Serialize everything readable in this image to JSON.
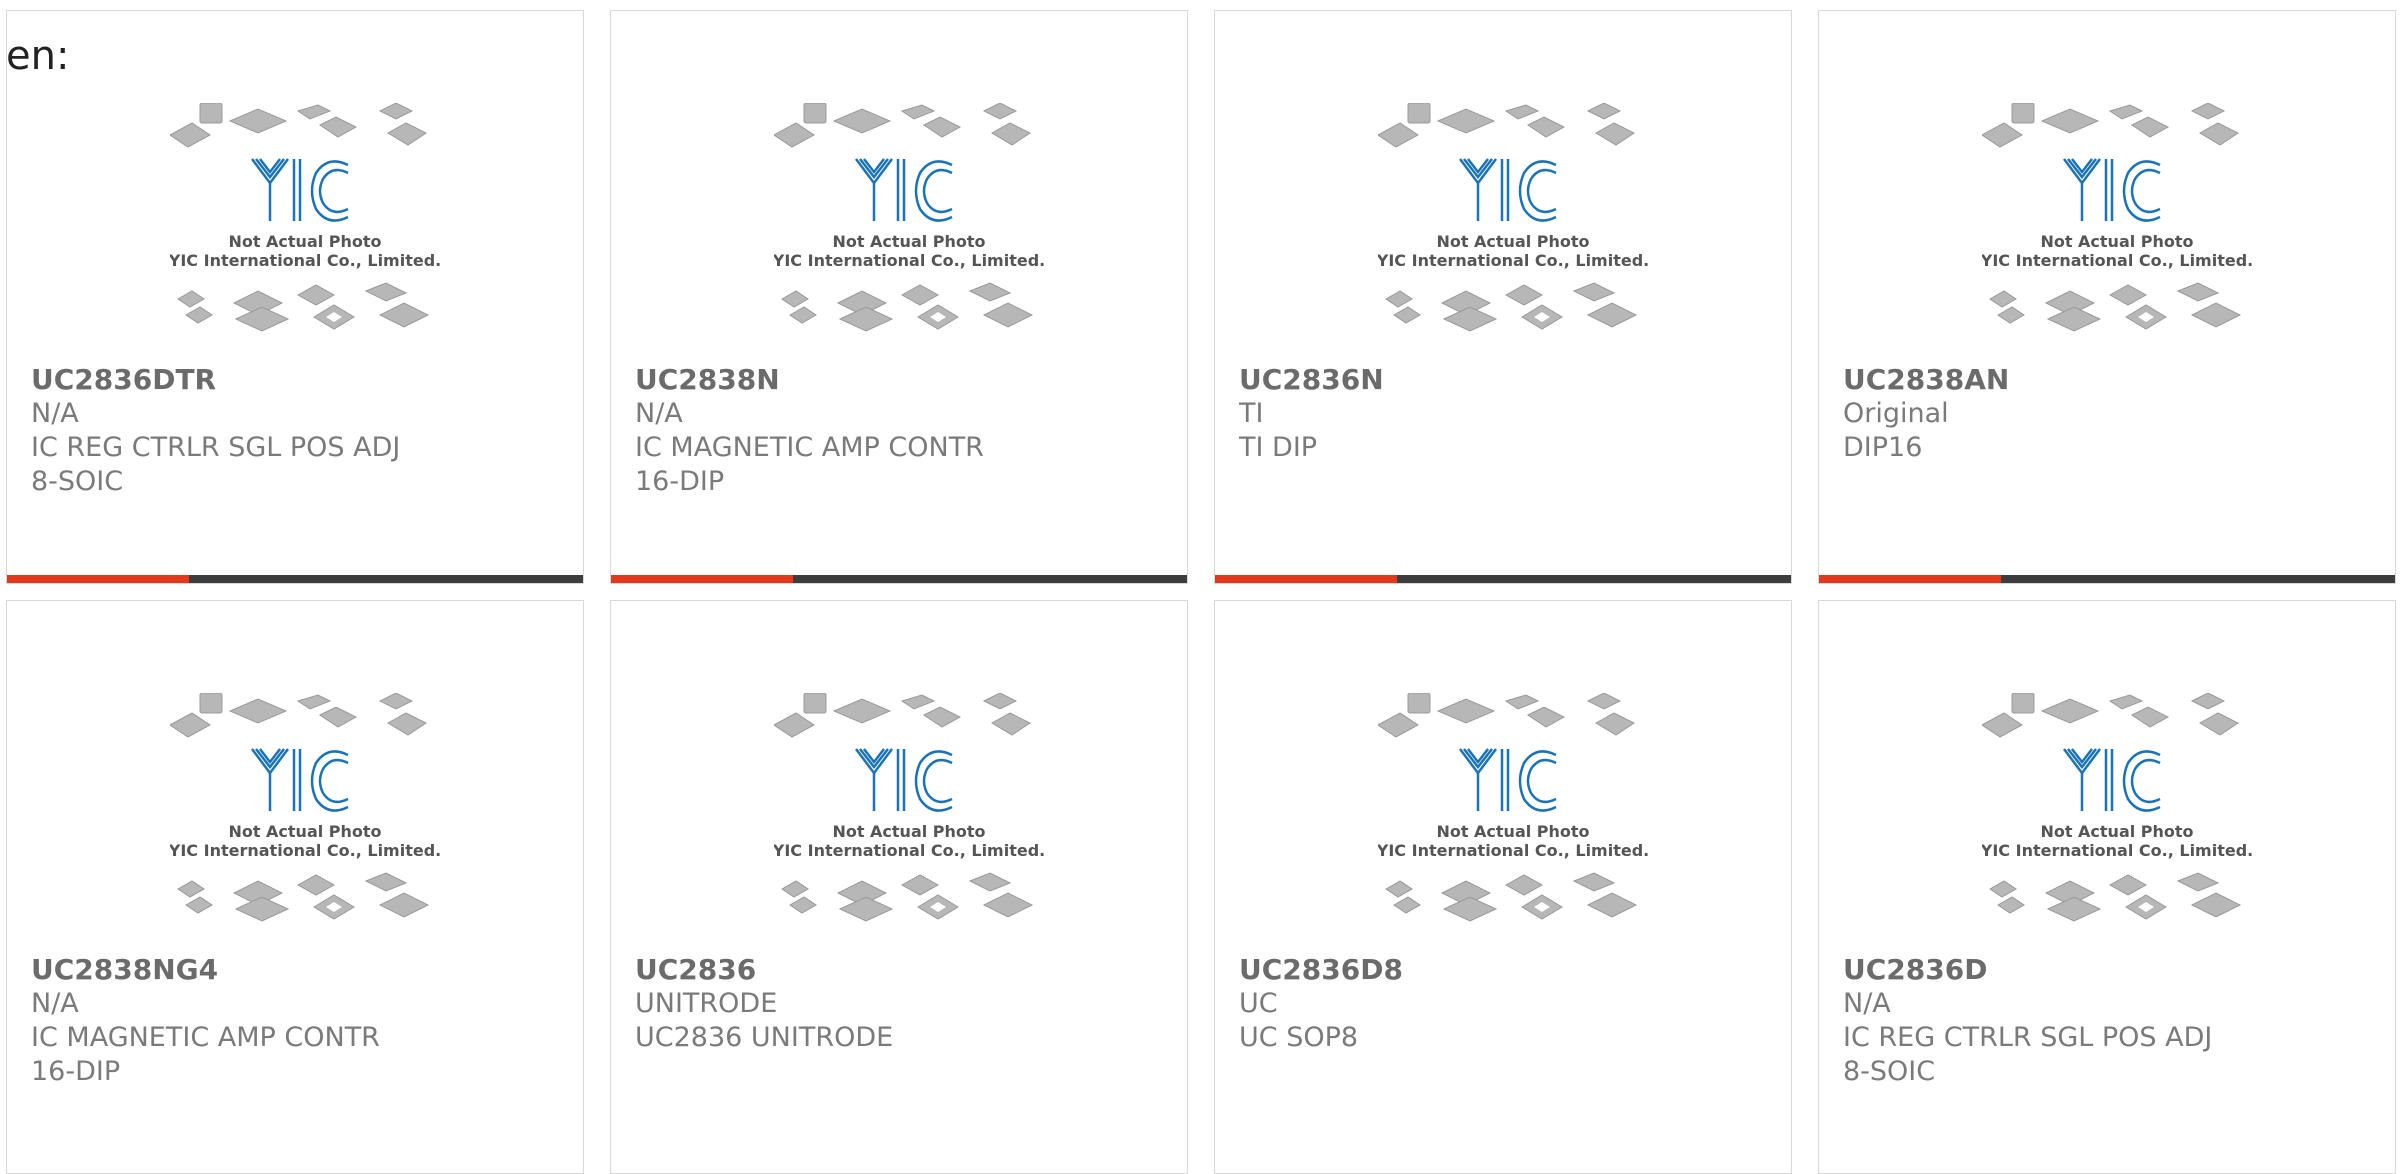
{
  "page": {
    "language_label": "en:"
  },
  "image_caption": {
    "line1": "Not Actual Photo",
    "line2": "YIC International Co., Limited."
  },
  "colors": {
    "accent_bar": "#e2381d",
    "dark_bar": "#3d3d3d",
    "logo_blue": "#1a73b9",
    "text_gray": "#7a7a7a"
  },
  "products": [
    {
      "part_number": "UC2836DTR",
      "manufacturer": "N/A",
      "description": "IC REG CTRLR SGL POS ADJ 8-SOIC"
    },
    {
      "part_number": "UC2838N",
      "manufacturer": "N/A",
      "description": "IC MAGNETIC AMP CONTR 16-DIP"
    },
    {
      "part_number": "UC2836N",
      "manufacturer": "TI",
      "description": "TI DIP"
    },
    {
      "part_number": "UC2838AN",
      "manufacturer": "Original",
      "description": "DIP16"
    },
    {
      "part_number": "UC2838NG4",
      "manufacturer": "N/A",
      "description": "IC MAGNETIC AMP CONTR 16-DIP"
    },
    {
      "part_number": "UC2836",
      "manufacturer": "UNITRODE",
      "description": "UC2836 UNITRODE"
    },
    {
      "part_number": "UC2836D8",
      "manufacturer": "UC",
      "description": "UC SOP8"
    },
    {
      "part_number": "UC2836D",
      "manufacturer": "N/A",
      "description": "IC REG CTRLR SGL POS ADJ 8-SOIC"
    }
  ]
}
